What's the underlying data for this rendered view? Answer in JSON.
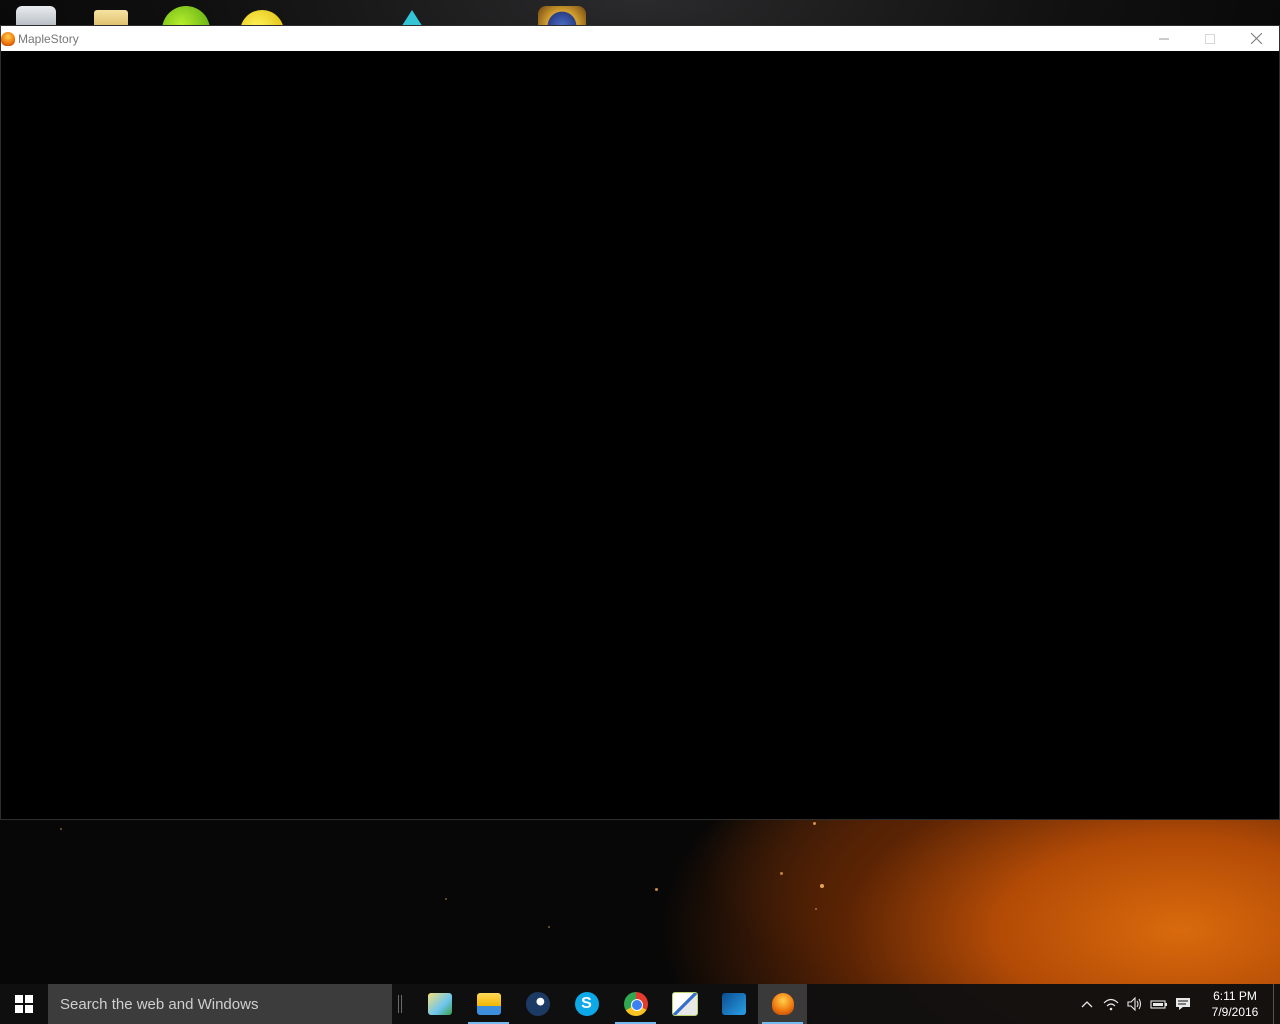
{
  "window": {
    "title": "MapleStory",
    "controls": {
      "minimize_icon": "minimize-icon",
      "maximize_icon": "maximize-icon",
      "close_icon": "close-icon"
    }
  },
  "desktop_icons": [
    "recycle-bin-icon",
    "folder-icon",
    "green-app-icon",
    "yellow-app-icon",
    "crystal-app-icon",
    "hearthstone-icon"
  ],
  "taskbar": {
    "search_placeholder": "Search the web and Windows",
    "apps": [
      {
        "name": "maps-folder-icon",
        "open": false,
        "active": false
      },
      {
        "name": "file-explorer-icon",
        "open": true,
        "active": false
      },
      {
        "name": "steam-icon",
        "open": false,
        "active": false
      },
      {
        "name": "skype-icon",
        "open": false,
        "active": false
      },
      {
        "name": "chrome-icon",
        "open": true,
        "active": false
      },
      {
        "name": "notepad-plus-icon",
        "open": false,
        "active": false
      },
      {
        "name": "battle-net-icon",
        "open": false,
        "active": false
      },
      {
        "name": "maplestory-icon",
        "open": true,
        "active": true
      }
    ],
    "skype_letter": "S",
    "tray": {
      "time": "6:11 PM",
      "date": "7/9/2016"
    }
  },
  "colors": {
    "titlebar": "#ffffff",
    "window_content": "#000000",
    "taskbar": "#101010",
    "accent": "#76b9ed"
  }
}
